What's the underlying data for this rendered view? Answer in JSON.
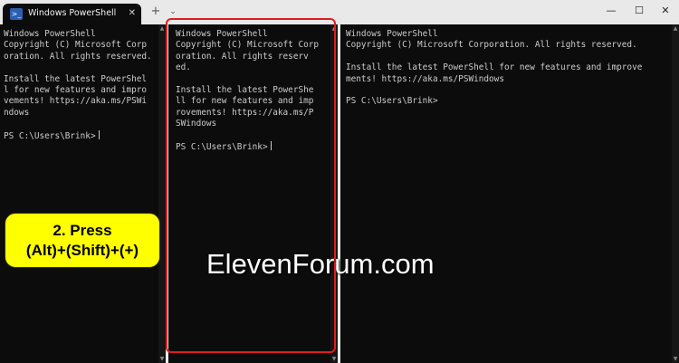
{
  "tab": {
    "title": "Windows PowerShell",
    "icon": "powershell-icon",
    "close_label": "✕"
  },
  "titlebar": {
    "new_tab_label": "+",
    "dropdown_label": "⌄",
    "minimize_label": "—",
    "maximize_label": "☐",
    "close_label": "✕"
  },
  "panes": {
    "left": {
      "text": "Windows PowerShell\nCopyright (C) Microsoft Corp\noration. All rights reserved.\n\nInstall the latest PowerShel\nl for new features and impro\nvements! https://aka.ms/PSWi\nndows\n\nPS C:\\Users\\Brink>"
    },
    "middle": {
      "text": "Windows PowerShell\nCopyright (C) Microsoft Corp\noration. All rights reserv\ned.\n\nInstall the latest PowerShe\nll for new features and imp\nrovements! https://aka.ms/P\nSWindows\n\nPS C:\\Users\\Brink>"
    },
    "right": {
      "text": "Windows PowerShell\nCopyright (C) Microsoft Corporation. All rights reserved.\n\nInstall the latest PowerShell for new features and improve\nments! https://aka.ms/PSWindows\n\nPS C:\\Users\\Brink>"
    }
  },
  "callout": {
    "line1": "2. Press",
    "line2": "(Alt)+(Shift)+(+)"
  },
  "watermark": "ElevenForum.com",
  "colors": {
    "highlight": "#e11d1d",
    "callout_bg": "#ffff00",
    "terminal_bg": "#0c0c0c",
    "terminal_text": "#cccccc"
  }
}
